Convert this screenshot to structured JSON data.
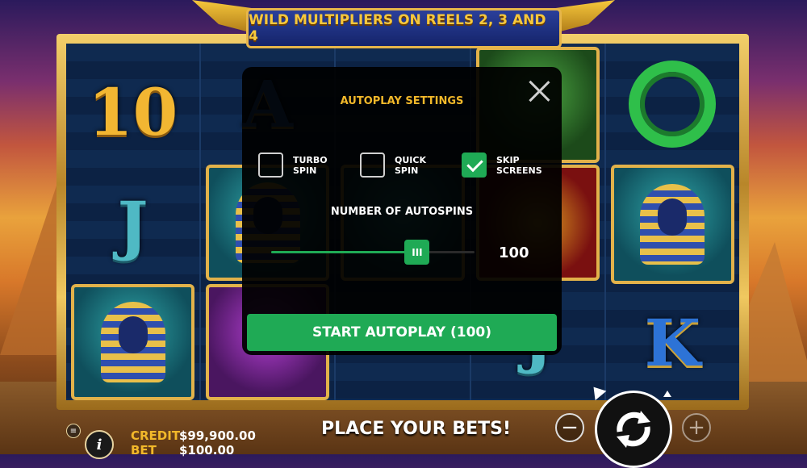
{
  "banner": {
    "text": "WILD MULTIPLIERS ON REELS 2, 3 AND 4"
  },
  "reels": {
    "reel1": {
      "top": "10",
      "mid": "J"
    },
    "reel2": {
      "top": "A"
    },
    "reel4": {
      "mid": "J"
    },
    "reel5": {
      "bottom": "K"
    }
  },
  "modal": {
    "title": "AUTOPLAY SETTINGS",
    "options": [
      {
        "label": "TURBO SPIN",
        "checked": false
      },
      {
        "label": "QUICK SPIN",
        "checked": false
      },
      {
        "label": "SKIP SCREENS",
        "checked": true
      }
    ],
    "autospins_label": "NUMBER OF AUTOSPINS",
    "slider_thumb_glyph": "III",
    "slider_value": "100",
    "slider_fraction": 0.72,
    "start_button": "START AUTOPLAY (100)"
  },
  "bottom_bar": {
    "credit_label": "CREDIT",
    "credit_value": "$99,900.00",
    "bet_label": "BET",
    "bet_value": "$100.00",
    "status": "PLACE YOUR BETS!",
    "menu_icon": "≡",
    "info_icon": "i",
    "minus_icon": "−",
    "plus_icon": "+"
  },
  "colors": {
    "accent_green": "#1faa55",
    "title_gold": "#f2b82a"
  }
}
